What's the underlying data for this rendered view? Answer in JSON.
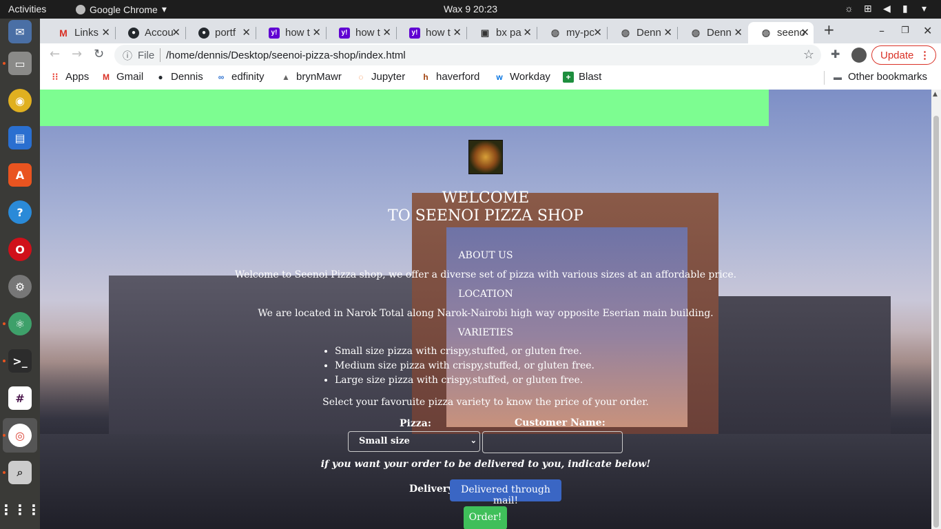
{
  "topbar": {
    "activities": "Activities",
    "app_name": "Google Chrome",
    "clock": "Wax 9  20:23"
  },
  "dock": {
    "items": [
      "thunderbird-icon",
      "files-icon",
      "rhythmbox-icon",
      "writer-icon",
      "software-icon",
      "help-icon",
      "opera-icon",
      "settings-icon",
      "atom-icon",
      "terminal-icon",
      "slack-icon",
      "chrome-icon",
      "search-icon",
      "apps-grid-icon"
    ]
  },
  "tabs": [
    {
      "title": "Links",
      "icon": "gmail-icon"
    },
    {
      "title": "Accou",
      "icon": "github-icon"
    },
    {
      "title": "portf",
      "icon": "github-icon"
    },
    {
      "title": "how t",
      "icon": "yahoo-icon"
    },
    {
      "title": "how t",
      "icon": "yahoo-icon"
    },
    {
      "title": "how t",
      "icon": "yahoo-icon"
    },
    {
      "title": "bx pa",
      "icon": "doc-icon"
    },
    {
      "title": "my-pc",
      "icon": "globe-icon"
    },
    {
      "title": "Denn",
      "icon": "globe-icon"
    },
    {
      "title": "Denn",
      "icon": "globe-icon"
    },
    {
      "title": "seeno",
      "icon": "globe-icon",
      "active": true
    }
  ],
  "omnibox": {
    "scheme": "File",
    "url": "/home/dennis/Desktop/seenoi-pizza-shop/index.html"
  },
  "update_label": "Update",
  "bookmarks": [
    {
      "label": "Apps"
    },
    {
      "label": "Gmail"
    },
    {
      "label": "Dennis"
    },
    {
      "label": "edfinity"
    },
    {
      "label": "brynMawr"
    },
    {
      "label": "Jupyter"
    },
    {
      "label": "haverford"
    },
    {
      "label": "Workday"
    },
    {
      "label": "Blast"
    }
  ],
  "other_bookmarks": "Other bookmarks",
  "page": {
    "welcome_line1": "WELCOME",
    "welcome_line2": "TO SEENOI PIZZA SHOP",
    "about_heading": "ABOUT US",
    "about_text": "Welcome to Seenoi Pizza shop, we offer a diverse set of pizza with various sizes at an affordable price.",
    "location_heading": "LOCATION",
    "location_text": "We are located in Narok Total along Narok-Nairobi high way opposite Eserian main building.",
    "varieties_heading": "VARIETIES",
    "varieties": [
      "Small size pizza with crispy,stuffed, or gluten free.",
      "Medium size pizza with crispy,stuffed, or gluten free.",
      "Large size pizza with crispy,stuffed, or gluten free."
    ],
    "select_text": "Select your favoruite pizza variety to know the price of your order.",
    "pizza_label": "Pizza:",
    "pizza_selected": "Small size",
    "customer_label": "Customer Name:",
    "customer_value": "",
    "delivery_note": "if you want your order to be delivered to you, indicate below!",
    "delivery_label": "Delivery:",
    "delivery_button": "Delivered through mail!",
    "order_button": "Order!"
  },
  "colors": {
    "green_bar": "#7dfd91",
    "delivery_button": "#3a66c4",
    "order_button": "#3fbf5a",
    "update_red": "#d93025"
  }
}
